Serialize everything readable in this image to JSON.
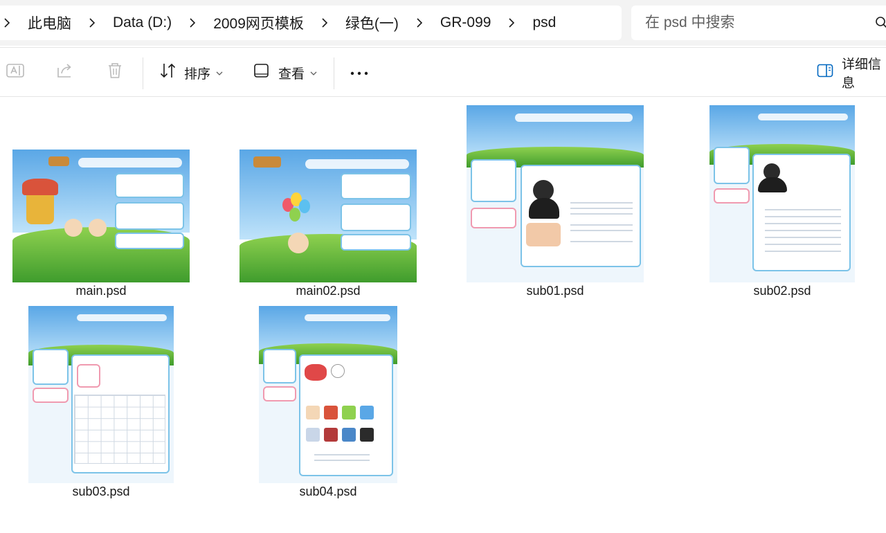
{
  "breadcrumb": {
    "items": [
      "此电脑",
      "Data (D:)",
      "2009网页模板",
      "绿色(一)",
      "GR-099",
      "psd"
    ]
  },
  "search": {
    "placeholder": "在 psd 中搜索"
  },
  "toolbar": {
    "sort_label": "排序",
    "view_label": "查看",
    "details_label": "详细信息"
  },
  "files": [
    {
      "name": "main.psd"
    },
    {
      "name": "main02.psd"
    },
    {
      "name": "sub01.psd"
    },
    {
      "name": "sub02.psd"
    },
    {
      "name": "sub03.psd"
    },
    {
      "name": "sub04.psd"
    }
  ],
  "colors": {
    "accent": "#0067c0",
    "sky": "#5aa7e6",
    "grass": "#5cb83a",
    "panel_border": "#7cc3e8"
  }
}
